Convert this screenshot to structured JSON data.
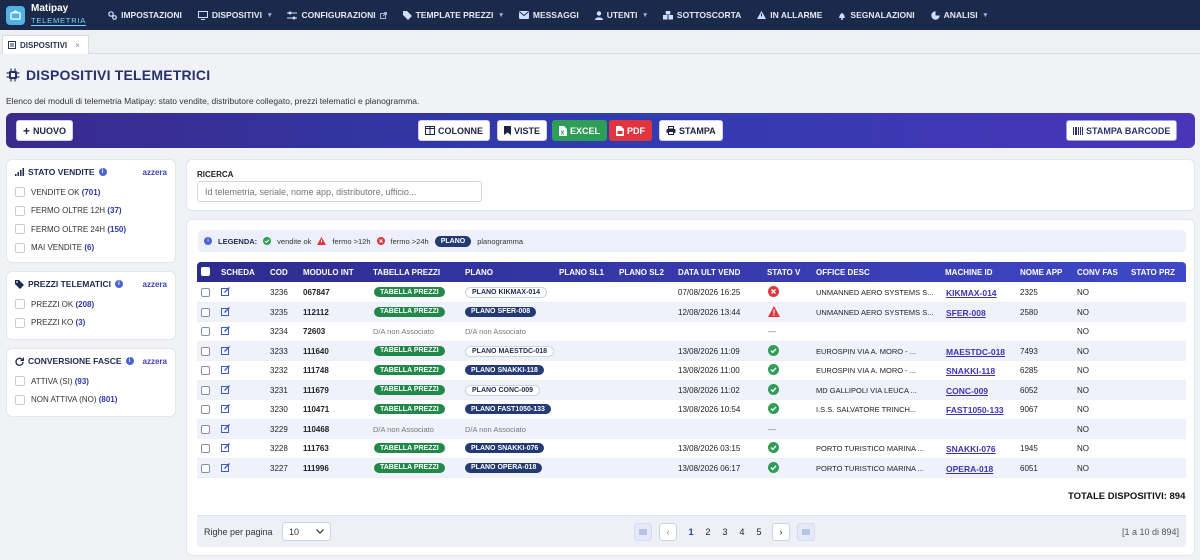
{
  "app": {
    "name": "Matipay",
    "sub": "TELEMETRIA"
  },
  "nav": [
    {
      "label": "IMPOSTAZIONI",
      "icon": "cog-icon",
      "caret": false
    },
    {
      "label": "DISPOSITIVI",
      "icon": "monitor-icon",
      "caret": true
    },
    {
      "label": "CONFIGURAZIONI",
      "icon": "sliders-icon",
      "caret": false,
      "external": true
    },
    {
      "label": "TEMPLATE PREZZI",
      "icon": "tag-icon",
      "caret": true
    },
    {
      "label": "MESSAGGI",
      "icon": "envelope-icon",
      "caret": false
    },
    {
      "label": "UTENTI",
      "icon": "user-icon",
      "caret": true
    },
    {
      "label": "SOTTOSCORTA",
      "icon": "boxes-icon",
      "caret": false
    },
    {
      "label": "IN ALLARME",
      "icon": "warning-icon",
      "caret": false
    },
    {
      "label": "SEGNALAZIONI",
      "icon": "bell-icon",
      "caret": false
    },
    {
      "label": "ANALISI",
      "icon": "chart-pie-icon",
      "caret": true
    }
  ],
  "tab": {
    "label": "DISPOSITIVI",
    "close": "×"
  },
  "page": {
    "title": "DISPOSITIVI TELEMETRICI",
    "description": "Elenco dei moduli di telemetria Matipay: stato vendite, distributore collegato, prezzi telematici e planogramma."
  },
  "toolbar": {
    "new": "NUOVO",
    "columns": "COLONNE",
    "views": "VISTE",
    "excel": "EXCEL",
    "pdf": "PDF",
    "print": "STAMPA",
    "barcode": "STAMPA BARCODE"
  },
  "filters": {
    "reset": "azzera",
    "sales": {
      "title": "STATO VENDITE",
      "options": [
        {
          "label": "VENDITE OK",
          "count": "(701)"
        },
        {
          "label": "FERMO OLTRE 12H",
          "count": "(37)"
        },
        {
          "label": "FERMO OLTRE 24H",
          "count": "(150)"
        },
        {
          "label": "MAI VENDITE",
          "count": "(6)"
        }
      ]
    },
    "prices": {
      "title": "PREZZI TELEMATICI",
      "options": [
        {
          "label": "PREZZI OK",
          "count": "(208)"
        },
        {
          "label": "PREZZI KO",
          "count": "(3)"
        }
      ]
    },
    "bands": {
      "title": "CONVERSIONE FASCE",
      "options": [
        {
          "label": "ATTIVA (SI)",
          "count": "(93)"
        },
        {
          "label": "NON ATTIVA (NO)",
          "count": "(801)"
        }
      ]
    }
  },
  "search": {
    "label": "RICERCA",
    "placeholder": "Id telemetria, seriale, nome app, distributore, ufficio..."
  },
  "legend": {
    "title": "LEGENDA:",
    "ok": "vendite ok",
    "w12": "fermo >12h",
    "w24": "fermo >24h",
    "plano": "PLANO",
    "plano_desc": "planogramma"
  },
  "columns": [
    "SCHEDA",
    "COD",
    "MODULO INT",
    "TABELLA PREZZI",
    "PLANO",
    "PLANO SL1",
    "PLANO SL2",
    "DATA ULT VEND",
    "STATO V",
    "OFFICE DESC",
    "MACHINE ID",
    "NOME APP",
    "CONV FAS",
    "STATO PRZ"
  ],
  "rows": [
    {
      "cod": "3236",
      "modulo": "067847",
      "tabella": "TABELLA PREZZI",
      "plano": "PLANO KIKMAX-014",
      "plano_style": "outline",
      "data": "07/08/2026 16:25",
      "stato": "error",
      "office": "UNMANNED AERO SYSTEMS S...",
      "machine": "KIKMAX-014",
      "app": "2325",
      "conv": "NO"
    },
    {
      "cod": "3235",
      "modulo": "112112",
      "tabella": "TABELLA PREZZI",
      "plano": "PLANO SFER-008",
      "plano_style": "dark",
      "data": "12/08/2026 13:44",
      "stato": "warning",
      "office": "UNMANNED AERO SYSTEMS S...",
      "machine": "SFER-008",
      "app": "2580",
      "conv": "NO"
    },
    {
      "cod": "3234",
      "modulo": "72603",
      "tabella": "D/A non Associato",
      "plano": "D/A non Associato",
      "plano_style": "text",
      "data": "",
      "stato": "none",
      "stato_text": "—",
      "office": "",
      "machine": "",
      "app": "",
      "conv": "NO"
    },
    {
      "cod": "3233",
      "modulo": "111640",
      "tabella": "TABELLA PREZZI",
      "plano": "PLANO MAESTDC-018",
      "plano_style": "outline",
      "data": "13/08/2026 11:09",
      "stato": "ok",
      "office": "EUROSPIN VIA A. MORO - ...",
      "machine": "MAESTDC-018",
      "app": "7493",
      "conv": "NO"
    },
    {
      "cod": "3232",
      "modulo": "111748",
      "tabella": "TABELLA PREZZI",
      "plano": "PLANO SNAKKI-118",
      "plano_style": "dark",
      "data": "13/08/2026 11:00",
      "stato": "ok",
      "office": "EUROSPIN VIA A. MORO - ...",
      "machine": "SNAKKI-118",
      "app": "6285",
      "conv": "NO"
    },
    {
      "cod": "3231",
      "modulo": "111679",
      "tabella": "TABELLA PREZZI",
      "plano": "PLANO CONC-009",
      "plano_style": "outline",
      "data": "13/08/2026 11:02",
      "stato": "ok",
      "office": "MD GALLIPOLI VIA LEUCA ...",
      "machine": "CONC-009",
      "app": "6052",
      "conv": "NO"
    },
    {
      "cod": "3230",
      "modulo": "110471",
      "tabella": "TABELLA PREZZI",
      "plano": "PLANO FAST1050-133",
      "plano_style": "dark",
      "data": "13/08/2026 10:54",
      "stato": "ok",
      "office": "I.S.S. SALVATORE TRINCH...",
      "machine": "FAST1050-133",
      "app": "9067",
      "conv": "NO"
    },
    {
      "cod": "3229",
      "modulo": "110468",
      "tabella": "D/A non Associato",
      "plano": "D/A non Associato",
      "plano_style": "text",
      "data": "",
      "stato": "none",
      "stato_text": "—",
      "office": "",
      "machine": "",
      "app": "",
      "conv": "NO"
    },
    {
      "cod": "3228",
      "modulo": "111763",
      "tabella": "TABELLA PREZZI",
      "plano": "PLANO SNAKKI-076",
      "plano_style": "dark",
      "data": "13/08/2026 03:15",
      "stato": "ok",
      "office": "PORTO TURISTICO MARINA ...",
      "machine": "SNAKKI-076",
      "app": "1945",
      "conv": "NO"
    },
    {
      "cod": "3227",
      "modulo": "111996",
      "tabella": "TABELLA PREZZI",
      "plano": "PLANO OPERA-018",
      "plano_style": "dark",
      "data": "13/08/2026 06:17",
      "stato": "ok",
      "office": "PORTO TURISTICO MARINA ...",
      "machine": "OPERA-018",
      "app": "6051",
      "conv": "NO"
    }
  ],
  "total": "TOTALE DISPOSITIVI: 894",
  "pagination": {
    "rows_label": "Righe per pagina",
    "rows_value": "10",
    "pages": [
      "1",
      "2",
      "3",
      "4",
      "5"
    ],
    "current": "1",
    "prev": "‹",
    "next": "›",
    "info": "[1 a 10 di 894]"
  },
  "colors": {
    "accent": "#2f3cae",
    "ok": "#2f9d57",
    "error": "#e0353f",
    "plano": "#233a74"
  }
}
